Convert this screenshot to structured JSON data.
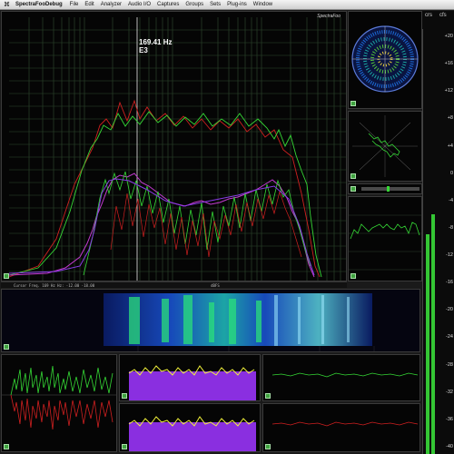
{
  "menubar": {
    "apple": "⌘",
    "app_name": "SpectraFooDebug",
    "items": [
      "File",
      "Edit",
      "Analyzer",
      "Audio I/O",
      "Captures",
      "Groups",
      "Sets",
      "Plug-ins",
      "Window"
    ]
  },
  "spectrum": {
    "brand": "SpectraFoo",
    "cursor_frequency": "169.41 Hz",
    "cursor_note": "E3"
  },
  "status": {
    "left_text": "Cursor Freq.  169 Hz  Hz:    -12.00  -18.00",
    "mid_text": "dBFS"
  },
  "meter": {
    "left_header": "crs",
    "right_header": "cfs",
    "scale": [
      "+20",
      "+16",
      "+12",
      "+8",
      "+4",
      "0",
      "-4",
      "-8",
      "-12",
      "-16",
      "-20",
      "-24",
      "-28",
      "-32",
      "-36",
      "-40"
    ],
    "level_left_db": -9,
    "level_right_db": -6
  },
  "colors": {
    "trace_green": "#35d835",
    "trace_red": "#d02020",
    "trace_magenta": "#c23ad0",
    "trace_purple": "#8a3ae6",
    "trace_yellow": "#f2f23a",
    "grid": "#2f4a2f"
  }
}
